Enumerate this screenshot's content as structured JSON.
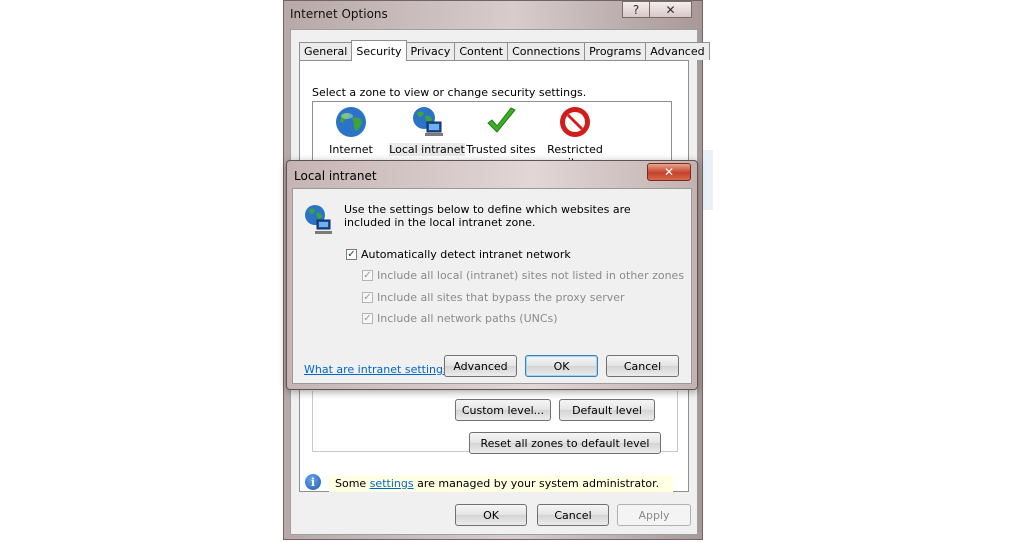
{
  "main_window": {
    "title": "Internet Options",
    "help_glyph": "?",
    "close_glyph": "✕",
    "tabs": [
      {
        "label": "General"
      },
      {
        "label": "Security"
      },
      {
        "label": "Privacy"
      },
      {
        "label": "Content"
      },
      {
        "label": "Connections"
      },
      {
        "label": "Programs"
      },
      {
        "label": "Advanced"
      }
    ],
    "active_tab": "Security",
    "zone_prompt": "Select a zone to view or change security settings.",
    "zones": [
      {
        "label": "Internet",
        "icon": "globe-icon"
      },
      {
        "label": "Local intranet",
        "icon": "intranet-icon"
      },
      {
        "label": "Trusted sites",
        "icon": "checkmark-icon"
      },
      {
        "label": "Restricted sites",
        "icon": "restricted-icon"
      }
    ],
    "custom_level_label": "Custom level...",
    "default_level_label": "Default level",
    "reset_all_label": "Reset all zones to default level",
    "info": {
      "prefix": "Some ",
      "link": "settings",
      "suffix": " are managed by your system administrator."
    },
    "ok_label": "OK",
    "cancel_label": "Cancel",
    "apply_label": "Apply"
  },
  "dialog": {
    "title": "Local intranet",
    "close_glyph": "✕",
    "description": "Use the settings below to define which websites are included in the local intranet zone.",
    "checkboxes": [
      {
        "label": "Automatically detect intranet network",
        "checked": true,
        "disabled": false
      },
      {
        "label": "Include all local (intranet) sites not listed in other zones",
        "checked": true,
        "disabled": true
      },
      {
        "label": "Include all sites that bypass the proxy server",
        "checked": true,
        "disabled": true
      },
      {
        "label": "Include all network paths (UNCs)",
        "checked": true,
        "disabled": true
      }
    ],
    "check_glyph": "✓",
    "help_link": "What are intranet settings?",
    "advanced_label": "Advanced",
    "ok_label": "OK",
    "cancel_label": "Cancel"
  },
  "colors": {
    "link": "#0066cc",
    "info_bar": "#ffffe1",
    "check_green": "#3cb024",
    "restricted_red": "#d11c1c"
  }
}
